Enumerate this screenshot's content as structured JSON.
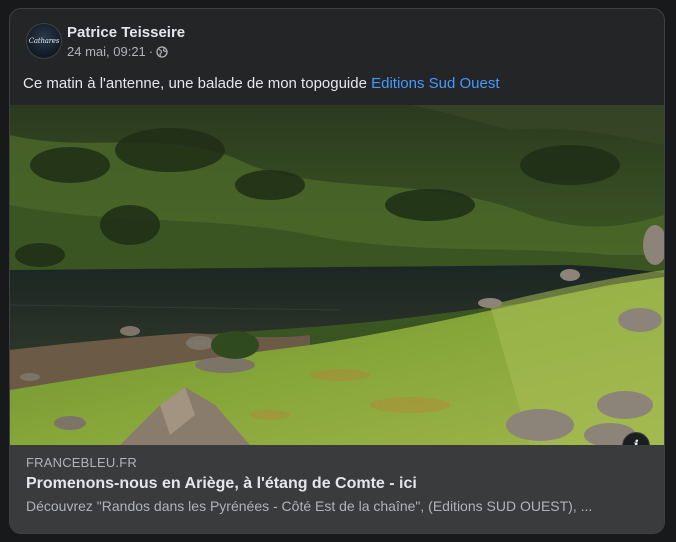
{
  "post": {
    "author": "Patrice Teisseire",
    "avatar_text": "Cathares",
    "timestamp": "24 mai, 09:21",
    "separator": "·",
    "privacy_icon": "globe-icon",
    "text": "Ce matin à l'antenne, une balade de mon topoguide ",
    "mention": "Editions Sud Ouest"
  },
  "link_preview": {
    "domain": "FRANCEBLEU.FR",
    "title": "Promenons-nous en Ariège, à l'étang de Comte - ici",
    "description": "Découvrez \"Randos dans les Pyrénées - Côté Est de la chaîne\", (Editions SUD OUEST), ...",
    "info_icon": "i"
  },
  "colors": {
    "background": "#18191a",
    "card": "#242526",
    "link": "#4599ff",
    "preview_bg": "#3a3b3c"
  }
}
